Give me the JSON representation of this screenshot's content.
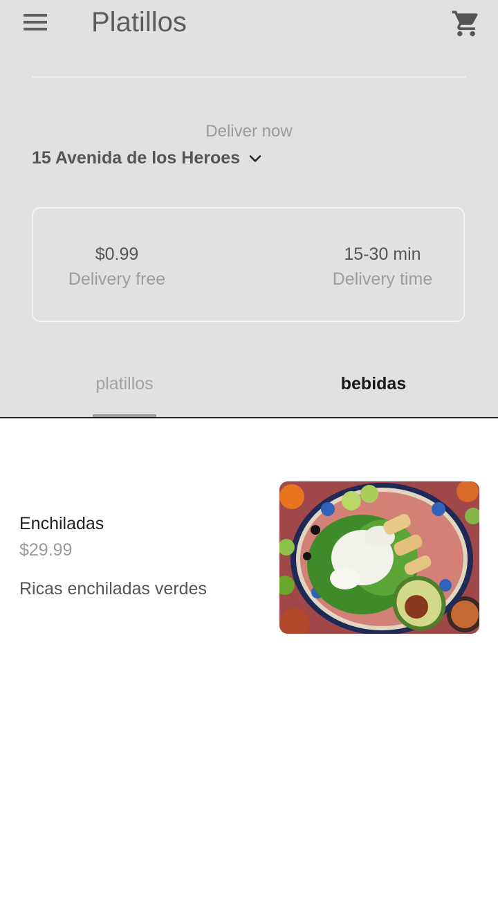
{
  "app_bar": {
    "title": "Platillos",
    "menu_icon": "menu-icon",
    "cart_icon": "shopping-cart-icon"
  },
  "delivery": {
    "when_label": "Deliver now",
    "address": "15 Avenida de los Heroes",
    "fee_value": "$0.99",
    "fee_label": "Delivery free",
    "time_value": "15-30 min",
    "time_label": "Delivery time"
  },
  "tabs": [
    {
      "label": "platillos"
    },
    {
      "label": "bebidas"
    }
  ],
  "dishes": [
    {
      "name": "Enchiladas",
      "price": "$29.99",
      "description": "Ricas enchiladas verdes"
    }
  ],
  "colors": {
    "header_bg": "#e1e1e1",
    "title": "#5c5c5c",
    "muted": "#9b9b9b"
  }
}
